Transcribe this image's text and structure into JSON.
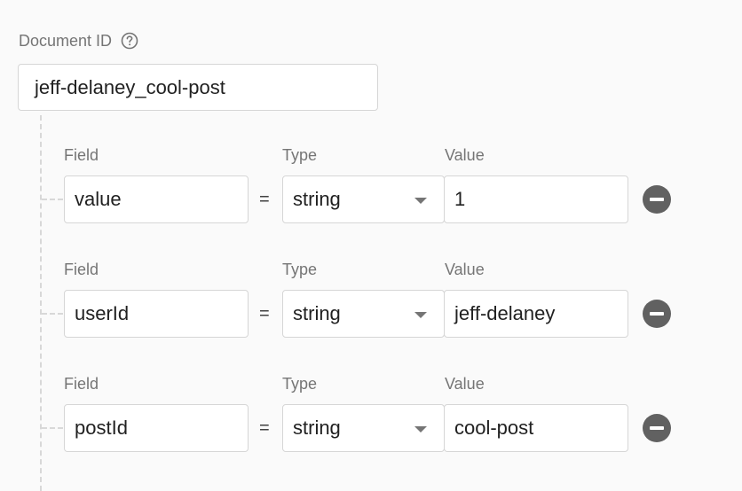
{
  "document": {
    "id_label": "Document ID",
    "id_value": "jeff-delaney_cool-post",
    "help_icon": "help-circle-icon"
  },
  "labels": {
    "field": "Field",
    "type": "Type",
    "value": "Value",
    "equals": "="
  },
  "rows": [
    {
      "field": "value",
      "type": "string",
      "value": "1"
    },
    {
      "field": "userId",
      "type": "string",
      "value": "jeff-delaney"
    },
    {
      "field": "postId",
      "type": "string",
      "value": "cool-post"
    }
  ],
  "icons": {
    "remove": "remove-circle-icon",
    "dropdown": "chevron-down-icon"
  },
  "colors": {
    "background": "#fafafa",
    "border": "#d6d6d6",
    "label": "#757575",
    "text": "#212121",
    "remove_button": "#616161"
  }
}
